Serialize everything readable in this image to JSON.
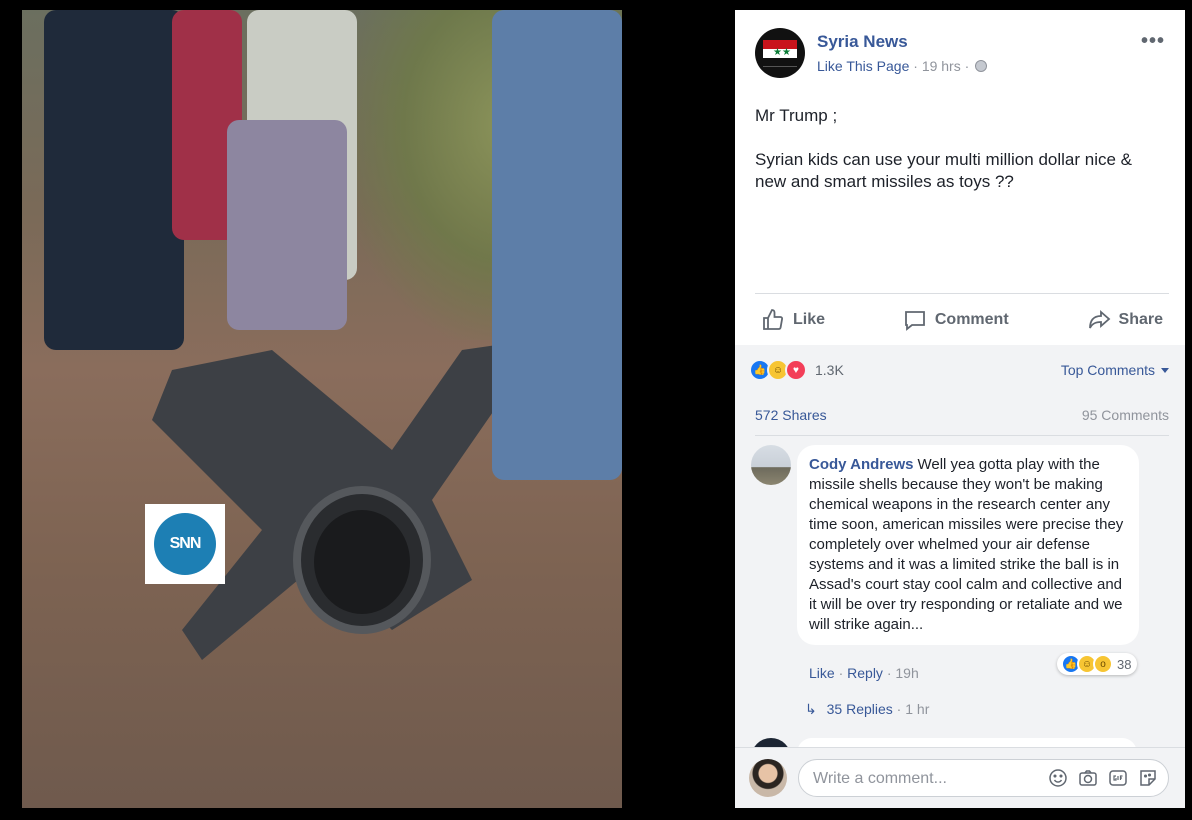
{
  "post": {
    "page_name": "Syria News",
    "like_page": "Like This Page",
    "time": "19 hrs",
    "text_line1": "Mr Trump ;",
    "text_line2": "Syrian kids can use your multi million dollar nice & new and smart missiles as toys ??",
    "more_icon": "more-horizontal-icon"
  },
  "photo": {
    "watermark": "SNN"
  },
  "actions": {
    "like": "Like",
    "comment": "Comment",
    "share": "Share"
  },
  "stats": {
    "reactions_count": "1.3K",
    "top_comments": "Top Comments",
    "shares": "572 Shares",
    "comments": "95 Comments"
  },
  "comment": {
    "author": "Cody Andrews",
    "text": "Well yea gotta play with the missile shells because they won't be making chemical weapons in the research center any time soon, american missiles were precise they completely over whelmed your air defense systems and it was a limited strike the ball is in Assad's court stay cool calm and collective and it will be over try responding or retaliate and we will strike again...",
    "reaction_count": "38",
    "like": "Like",
    "reply": "Reply",
    "time": "19h",
    "replies": "35 Replies",
    "replies_time": "1 hr"
  },
  "compose": {
    "placeholder": "Write a comment..."
  },
  "colors": {
    "link": "#385898",
    "muted": "#90949c",
    "background": "#f2f3f5"
  }
}
